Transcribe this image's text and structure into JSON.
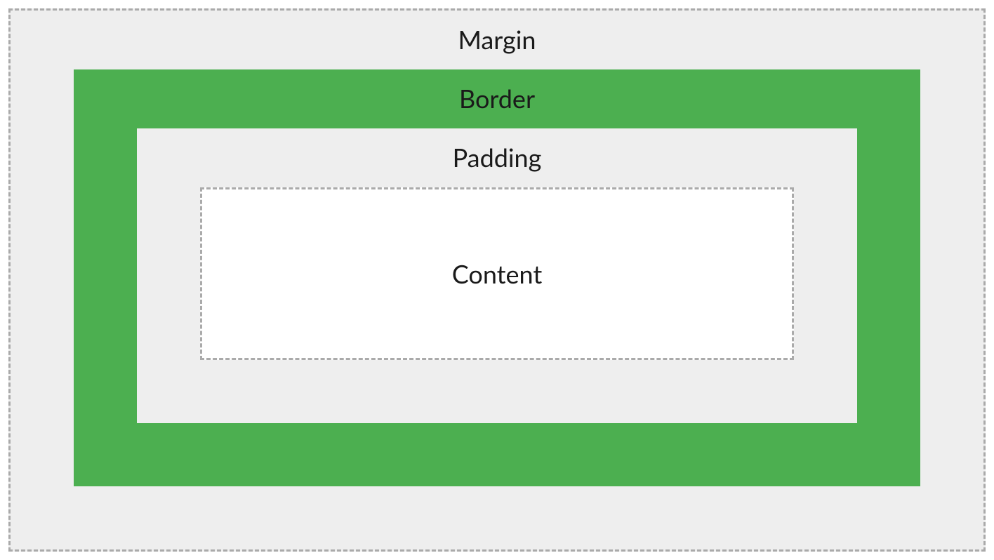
{
  "boxModel": {
    "margin": {
      "label": "Margin"
    },
    "border": {
      "label": "Border",
      "color": "#4CAF50"
    },
    "padding": {
      "label": "Padding"
    },
    "content": {
      "label": "Content"
    }
  }
}
